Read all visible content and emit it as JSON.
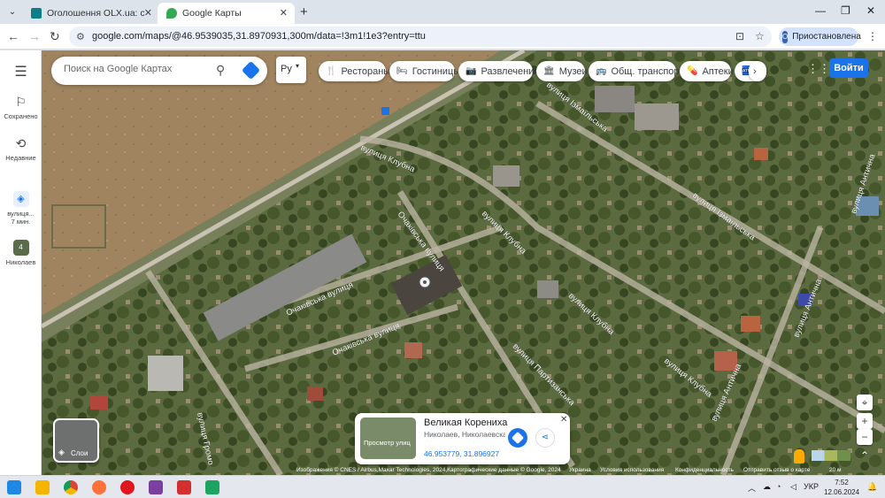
{
  "browser": {
    "tabs": [
      {
        "title": "Оголошення OLX.ua: сервіс ог",
        "favicon_color": "#0d7e87"
      },
      {
        "title": "Google Карты",
        "favicon_color": "#34a853"
      }
    ],
    "url": "google.com/maps/@46.9539035,31.8970931,300m/data=!3m1!1e3?entry=ttu",
    "profile_label": "Приостановлена",
    "profile_initial": "О"
  },
  "rail": {
    "saved": "Сохранено",
    "recent": "Недавние",
    "history_item": "вулиця...",
    "history_time": "7 мин.",
    "city_item": "Николаев"
  },
  "search": {
    "placeholder": "Поиск на Google Картах"
  },
  "lang_button": "Ру",
  "chips": [
    {
      "label": "Рестораны",
      "icon": "🍴"
    },
    {
      "label": "Гостиницы",
      "icon": "🛏"
    },
    {
      "label": "Развлечения",
      "icon": "📷"
    },
    {
      "label": "Музеи",
      "icon": "🏛"
    },
    {
      "label": "Общ. транспорт",
      "icon": "🚌"
    },
    {
      "label": "Аптеки",
      "icon": "💊"
    },
    {
      "label": "Б",
      "icon": "🏧"
    }
  ],
  "signin_label": "Войти",
  "layers_label": "Слои",
  "streets": [
    "вулиця Клубна",
    "Очаківська вулиця",
    "вулиця Клубна",
    "вулиця Ізмаїльська",
    "вулиця Ізмаїльська",
    "Очаківська вулиця",
    "Очаківська вулиця",
    "вулиця Клубна",
    "вулиця Клубна",
    "вулиця Партизанська",
    "вулиця Антична",
    "вулиця Антична",
    "вулиця Антична",
    "вулиця Громо"
  ],
  "place_card": {
    "name": "Великая Корениха",
    "address": "Николаев, Николаевская область",
    "coords": "46.953779, 31.896927",
    "thumb_label": "Просмотр улиц"
  },
  "attribution": {
    "imagery": "Изображения © CNES / Airbus,Maxar Technologies, 2024,Картографические данные © Google, 2024",
    "country": "Украина",
    "terms": "Условия использования",
    "privacy": "Конфиденциальность",
    "feedback": "Отправить отзыв о карте",
    "scale": "20 м"
  },
  "taskbar": {
    "lang": "УКР",
    "time": "7:52",
    "date": "12.06.2024"
  }
}
